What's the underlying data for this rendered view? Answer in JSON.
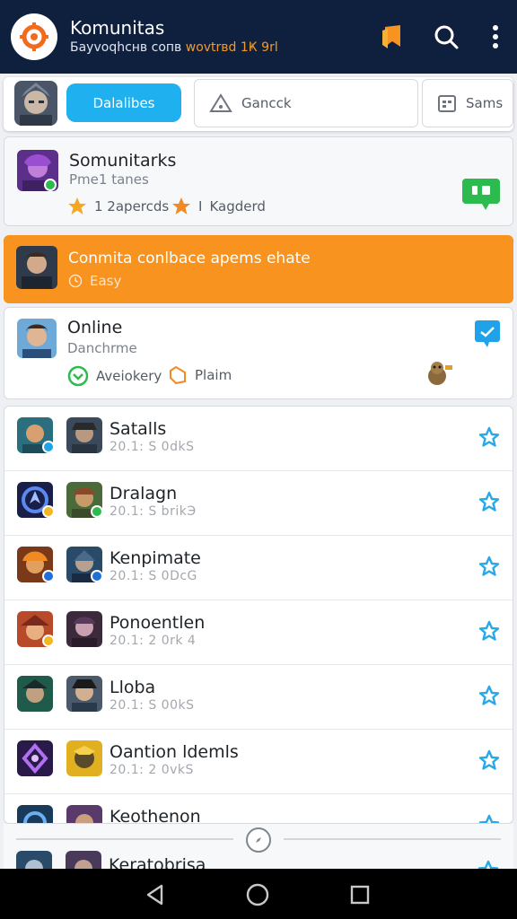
{
  "appbar": {
    "title": "Komunitas",
    "subtitle_main": "Баyvoqhcнв сопв ",
    "subtitle_accent": "wovtrвd 1Ҝ 9rl",
    "icons": [
      "bookmark-icon",
      "search-icon",
      "more-vert-icon"
    ]
  },
  "filters": {
    "primary_label": "Dalalibes",
    "check_label": "Gancck",
    "same_label": "Sams"
  },
  "community_card": {
    "name": "Somunitarks",
    "subtitle": "Pme1 tanes",
    "stat1": "1 2apercds",
    "stat2": "Kagderd",
    "stat2_prefix": "I"
  },
  "banner": {
    "title": "Conmita conlbace apems ehate",
    "sub": "Easy"
  },
  "online_card": {
    "name": "Online",
    "subtitle": "Danchrme",
    "stat1": "Aveiokery",
    "stat2": "Plaim"
  },
  "list": [
    {
      "name": "Satalls",
      "meta": "20.1: S 0dkS"
    },
    {
      "name": "Dralagn",
      "meta": "20.1: S brikЭ"
    },
    {
      "name": "Kenpimate",
      "meta": "20.1: S 0DcG"
    },
    {
      "name": "Ponoentlen",
      "meta": "20.1: 2 0rk 4"
    },
    {
      "name": "Lloba",
      "meta": "20.1: S 00kS"
    },
    {
      "name": "Oantion ldemls",
      "meta": "20.1: 2 0vkS"
    },
    {
      "name": "Keothenon",
      "meta": ""
    }
  ],
  "peek_row": {
    "name": "Keratobrisa"
  },
  "colors": {
    "appbar": "#0f1f3e",
    "accent_orange": "#f7931e",
    "primary_blue": "#1fb0f0",
    "chat_green": "#2dbb4f",
    "star_blue": "#29a8e6"
  }
}
